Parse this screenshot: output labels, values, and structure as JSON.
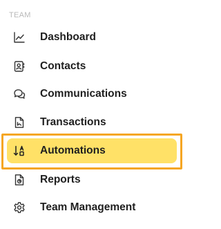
{
  "sidebar": {
    "section_label": "TEAM",
    "items": [
      {
        "label": "Dashboard",
        "icon": "chart-line-icon",
        "active": false
      },
      {
        "label": "Contacts",
        "icon": "contact-book-icon",
        "active": false
      },
      {
        "label": "Communications",
        "icon": "chat-bubbles-icon",
        "active": false
      },
      {
        "label": "Transactions",
        "icon": "document-icon",
        "active": false
      },
      {
        "label": "Automations",
        "icon": "sort-automation-icon",
        "active": true
      },
      {
        "label": "Reports",
        "icon": "report-icon",
        "active": false
      },
      {
        "label": "Team Management",
        "icon": "gear-icon",
        "active": false
      }
    ]
  },
  "colors": {
    "active_background": "#ffe167",
    "focus_outline": "#f5a623",
    "text": "#1f1f1f",
    "section_label": "#b9b9b9"
  }
}
